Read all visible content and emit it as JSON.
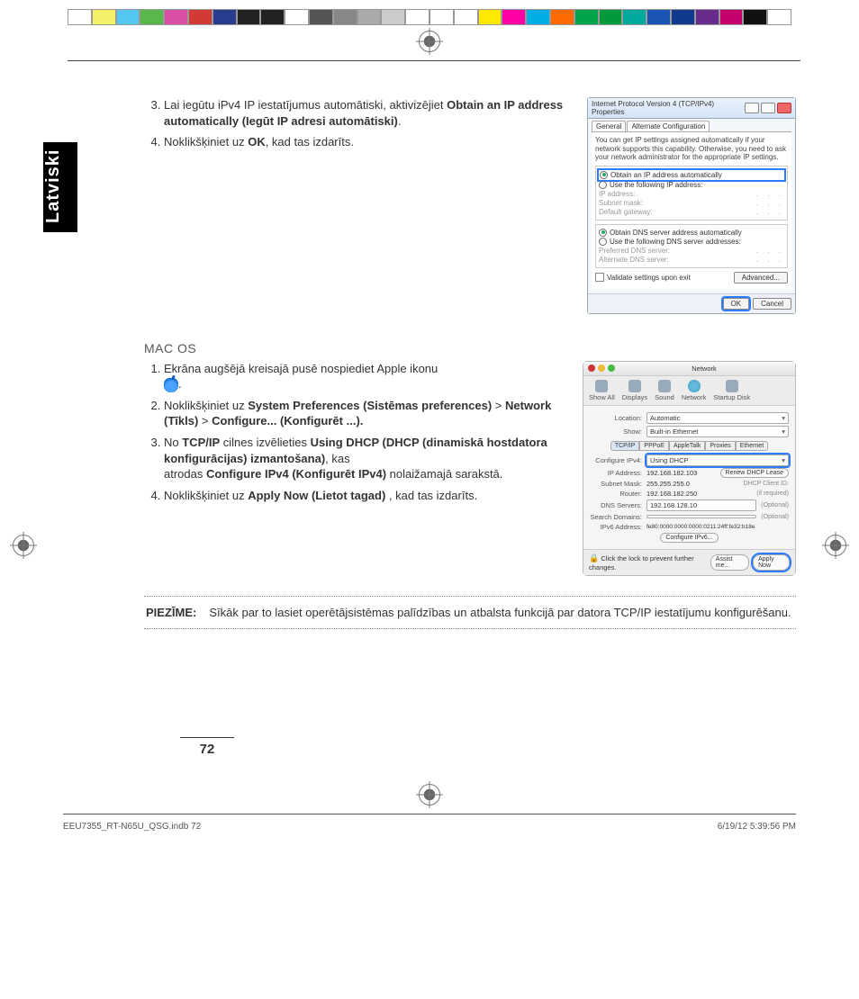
{
  "sidebar_label": "Latviski",
  "steps_win": {
    "s3_pre": "Lai iegūtu iPv4 IP iestatījumus automātiski, aktivizējiet ",
    "s3_bold": "Obtain an IP address automatically (Iegūt IP adresi automātiski)",
    "s3_post": ".",
    "s4_pre": "Noklikšķiniet uz ",
    "s4_bold": "OK",
    "s4_post": ", kad tas izdarīts."
  },
  "win_dialog": {
    "title": "Internet Protocol Version 4 (TCP/IPv4) Properties",
    "tab_general": "General",
    "tab_alt": "Alternate Configuration",
    "desc": "You can get IP settings assigned automatically if your network supports this capability. Otherwise, you need to ask your network administrator for the appropriate IP settings.",
    "r_auto_ip": "Obtain an IP address automatically",
    "r_use_ip": "Use the following IP address:",
    "f_ip": "IP address:",
    "f_mask": "Subnet mask:",
    "f_gw": "Default gateway:",
    "r_auto_dns": "Obtain DNS server address automatically",
    "r_use_dns": "Use the following DNS server addresses:",
    "f_pdns": "Preferred DNS server:",
    "f_adns": "Alternate DNS server:",
    "chk_validate": "Validate settings upon exit",
    "btn_adv": "Advanced...",
    "btn_ok": "OK",
    "btn_cancel": "Cancel"
  },
  "macos_heading": "MAC OS",
  "steps_mac": {
    "s1": "Ekrāna augšējā kreisajā pusē nospiediet Apple ikonu ",
    "s1_post": ".",
    "s2_pre": "Noklikšķiniet uz ",
    "s2_b1": "System Preferences (Sistēmas preferences)",
    "s2_gt1": " > ",
    "s2_b2": "Network (Tīkls)",
    "s2_gt2": " > ",
    "s2_b3": "Configure... (Konfigurēt ...).",
    "s3_pre": "No ",
    "s3_b1": "TCP/IP",
    "s3_mid1": " cilnes izvēlieties ",
    "s3_b2": "Using DHCP (DHCP (dinamiskā hostdatora konfigurācijas) izmantošana)",
    "s3_mid2": ", kas",
    "s3_line2a": "atrodas ",
    "s3_b3": "Configure IPv4 (Konfigurēt IPv4)",
    "s3_line2b": " nolaižamajā sarakstā.",
    "s4_pre": "Noklikšķiniet uz ",
    "s4_bold": "Apply Now (Lietot tagad) ",
    "s4_post": ", kad tas izdarīts."
  },
  "mac_pane": {
    "title": "Network",
    "icons": [
      "Show All",
      "Displays",
      "Sound",
      "Network",
      "Startup Disk"
    ],
    "loc_label": "Location:",
    "loc_value": "Automatic",
    "show_label": "Show:",
    "show_value": "Built-in Ethernet",
    "tabs": [
      "TCP/IP",
      "PPPoE",
      "AppleTalk",
      "Proxies",
      "Ethernet"
    ],
    "cfg_label": "Configure IPv4:",
    "cfg_value": "Using DHCP",
    "ip_label": "IP Address:",
    "ip_value": "192.168.182.103",
    "renew": "Renew DHCP Lease",
    "mask_label": "Subnet Mask:",
    "mask_value": "255.255.255.0",
    "client_label": "DHCP Client ID:",
    "client_hint": "(if required)",
    "router_label": "Router:",
    "router_value": "192.168.182.250",
    "dns_label": "DNS Servers:",
    "dns_value": "192.168.128.10",
    "optional": "(Optional)",
    "search_label": "Search Domains:",
    "ipv6_label": "IPv6 Address:",
    "ipv6_value": "fe80:0000:0000:0000:0211:24ff:fe32:b18e",
    "cfg_ipv6": "Configure IPv6...",
    "lock_text": "Click the lock to prevent further changes.",
    "assist": "Assist me...",
    "apply": "Apply Now"
  },
  "note": {
    "label": "PIEZĪME:",
    "text": "Sīkāk par to lasiet operētājsistēmas palīdzības un atbalsta funkcijā par datora TCP/IP iestatījumu konfigurēšanu."
  },
  "page_number": "72",
  "footer_left": "EEU7355_RT-N65U_QSG.indb   72",
  "footer_right": "6/19/12   5:39:56 PM",
  "colorbar": [
    "#fff",
    "#f3f069",
    "#53c7ef",
    "#58b84a",
    "#d84fa3",
    "#d13a35",
    "#2a3c8f",
    "#222",
    "#222",
    "#fff",
    "#555",
    "#888",
    "#aaa",
    "#ccc",
    "#fff",
    "#fff",
    "#fff",
    "#ffe900",
    "#ff00a6",
    "#00aee6",
    "#ff6a00",
    "#00a44a",
    "#009a3d",
    "#00a99d",
    "#1a55b4",
    "#113a8f",
    "#6a2b8f",
    "#c3006b",
    "#111",
    "#fff"
  ]
}
